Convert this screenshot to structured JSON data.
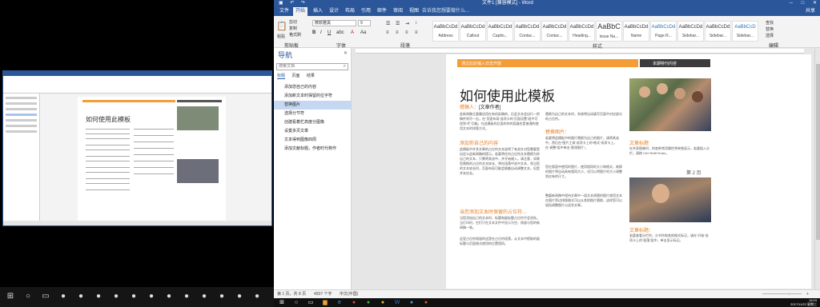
{
  "word": {
    "title": "文件1 [兼容模式] - Word",
    "tabs": [
      "文件",
      "开始",
      "插入",
      "设计",
      "布局",
      "引用",
      "邮件",
      "审阅",
      "视图"
    ],
    "active_tab": "开始",
    "tell_me": "告诉我您想要做什么...",
    "share": "共享",
    "ribbon": {
      "paste": "粘贴",
      "cut": "剪切",
      "copy": "复制",
      "format_painter": "格式刷",
      "clipboard_label": "剪贴板",
      "font_name": "微软雅黑",
      "font_size": "9",
      "font_label": "字体",
      "paragraph_label": "段落",
      "styles_label": "样式",
      "find": "查找",
      "replace": "替换",
      "select": "选择",
      "editing_label": "编辑",
      "styles": [
        {
          "sample": "AaBbCcDd",
          "name": "Address"
        },
        {
          "sample": "AaBbCcDd",
          "name": "Callout"
        },
        {
          "sample": "AaBbCcDd",
          "name": "Captio..."
        },
        {
          "sample": "AaBbCcDd",
          "name": "Contac..."
        },
        {
          "sample": "AaBbCcDd",
          "name": "Contac..."
        },
        {
          "sample": "AaBbCcDd",
          "name": "Heading..."
        },
        {
          "sample": "AaBbC",
          "name": "Issue Nu..."
        },
        {
          "sample": "AaBbCcDd",
          "name": "Name"
        },
        {
          "sample": "AaBbCcDd",
          "name": "Page R..."
        },
        {
          "sample": "AaBbCcDd",
          "name": "Sidebar..."
        },
        {
          "sample": "AaBbCcDd",
          "name": "Sidebar..."
        },
        {
          "sample": "AaBbCcD",
          "name": "Sidebar..."
        }
      ]
    }
  },
  "nav": {
    "title": "导航",
    "search_placeholder": "搜索文档",
    "tabs": [
      "标题",
      "页面",
      "结果"
    ],
    "items": [
      "添加您自己的内容",
      "添加新文本时保留的位字符",
      "替换图片",
      "选择分节符",
      "创建看着栏高度分图像",
      "设置多页文章",
      "文本得到图像四周",
      "添加文献标题，作者时代称作"
    ],
    "selected_index": 2
  },
  "page": {
    "orange_bar": "通过此处输入日志开放",
    "dark_bar": "本期特刊内容",
    "title": "如何使用此模板",
    "author_label": "撰稿人：",
    "author": "[文章作者]",
    "intro": "此新闻稿主要最适用在有机彩稿的，后此文本会自行一把稿件则写一出，在“页面布局”选项卡的“页面设置”组中可找到“栏”功能。在此模板的后面的你的容器也是普通的使用文本的排版方式。",
    "head1": "添加你自己的内容",
    "body1": "此模板中许多文章的占位符文本说明了有关针对您需要是自定义此新闻稿的提示。若要将任何占位符文本替换为你自己的文本，只需将其选中，并开始键入。请注意，如果您替换的占位符文本较长，将在段落中选中文本，则当您的文本较长时，页面布局可能会随着自动调整文本，但是并未应去。",
    "head2": "当您添加文本时保留的占位符…",
    "body2": "当您添加自己的文本时，标题和副标题占位符不会消失。当打印时，它们只在文本文件中显示为空，保留与您的新闻稿一致。",
    "body2b": "这里占位符保留的这是在占位符段落，从文本中提取的副标题与页面格式使用的位置相同。",
    "col2_body": "替换为自己的文本时，系统将自动填写页面中对应部分的占位符。",
    "head3": "替换图片：",
    "col2_body2": "若要将此模板中的图片替换为自己的图片，请将其选中，然后在“图片工具”选项卡上的“格式”选项卡上，在“调整”组中单击“更改图片”。",
    "col2_body3": "您在版面中使用的图片，使用相同的大小和格式，新换的图片将自动具有相同大小，也可以将图片的大小调整到应有的尺寸。",
    "col2_body4": "整篇新闻稿中保持文章中一段文本周围的图片使用文本在图片旁边排版格式可以从其他图片替换，这样您可以轻松调整图片以适合文章。",
    "side_head1": "文章标题",
    "side_body1": "在共享图像时，的各种常用属性将单独显示，若要插入分栏，请按 Ctrl+Shift+Enter。",
    "page_num": "第 2 页",
    "side_head2": "文章标题：",
    "side_body2": "若要查看分栏符，分节符和其他格式标记，请在“开始”选项卡上的“段落”组中，单击显示标记。"
  },
  "status": {
    "page": "第 1 页，共 8 页",
    "words": "4937 个字",
    "lang": "中文(中国)",
    "zoom": "+"
  },
  "taskbar": {
    "time": "15:03",
    "date": "2017/11/22 星期三"
  },
  "left": {
    "title": "如何使用此模板"
  }
}
